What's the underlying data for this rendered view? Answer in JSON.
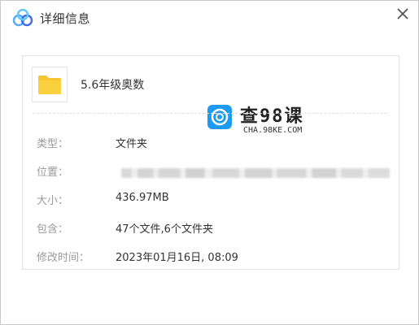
{
  "window": {
    "title": "详细信息"
  },
  "file": {
    "name": "5.6年级奥数"
  },
  "watermark": {
    "text": "查98课",
    "sub": "CHA.98KE.COM"
  },
  "details": {
    "type": {
      "label": "类型：",
      "value": "文件夹"
    },
    "location": {
      "label": "位置：",
      "value": ""
    },
    "size": {
      "label": "大小：",
      "value": "436.97MB"
    },
    "contains": {
      "label": "包含：",
      "value": "47个文件,6个文件夹"
    },
    "modified": {
      "label": "修改时间：",
      "value": "2023年01月16日, 08:09"
    }
  },
  "colors": {
    "folder": "#f7c531",
    "accent": "#1e9bf0",
    "label": "#9a9a9a",
    "text": "#333333"
  },
  "icons": {
    "app": "cloud-logo-icon",
    "close": "close-icon",
    "file": "folder-icon"
  }
}
